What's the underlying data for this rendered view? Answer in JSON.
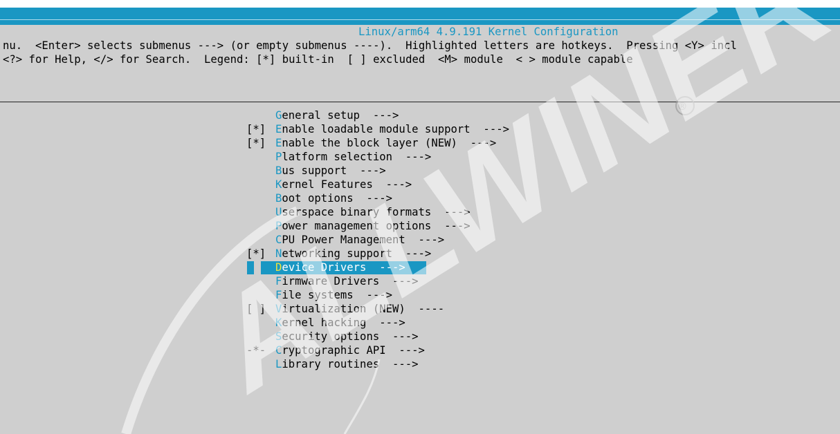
{
  "window": {
    "title": "Linux/arm64 4.9.191 Kernel Configuration"
  },
  "help": {
    "line1": "nu.  <Enter> selects submenus ---> (or empty submenus ----).  Highlighted letters are hotkeys.  Pressing <Y> incl",
    "line2": "<?> for Help, </> for Search.  Legend: [*] built-in  [ ] excluded  <M> module  < > module capable"
  },
  "menu": {
    "items": [
      {
        "prefix": "   ",
        "hotkey": "G",
        "rest": "eneral setup  --->",
        "selected": false
      },
      {
        "prefix": "[*]",
        "hotkey": "E",
        "rest": "nable loadable module support  --->",
        "selected": false
      },
      {
        "prefix": "[*]",
        "hotkey": "E",
        "rest": "nable the block layer (NEW)  --->",
        "selected": false
      },
      {
        "prefix": "   ",
        "hotkey": "P",
        "rest": "latform selection  --->",
        "selected": false
      },
      {
        "prefix": "   ",
        "hotkey": "B",
        "rest": "us support  --->",
        "selected": false
      },
      {
        "prefix": "   ",
        "hotkey": "K",
        "rest": "ernel Features  --->",
        "selected": false
      },
      {
        "prefix": "   ",
        "hotkey": "B",
        "rest": "oot options  --->",
        "selected": false
      },
      {
        "prefix": "   ",
        "hotkey": "U",
        "rest": "serspace binary formats  --->",
        "selected": false
      },
      {
        "prefix": "   ",
        "hotkey": "P",
        "rest": "ower management options  --->",
        "selected": false
      },
      {
        "prefix": "   ",
        "hotkey": "C",
        "rest": "PU Power Management  --->",
        "selected": false
      },
      {
        "prefix": "[*]",
        "hotkey": "N",
        "rest": "etworking support  --->",
        "selected": false
      },
      {
        "prefix": "   ",
        "hotkey": "D",
        "rest": "evice Drivers  --->",
        "selected": true
      },
      {
        "prefix": "   ",
        "hotkey": "F",
        "rest": "irmware Drivers  --->",
        "selected": false
      },
      {
        "prefix": "   ",
        "hotkey": "F",
        "rest": "ile systems  --->",
        "selected": false
      },
      {
        "prefix": "[ ]",
        "hotkey": "V",
        "rest": "irtualization (NEW)  ----",
        "selected": false
      },
      {
        "prefix": "   ",
        "hotkey": "K",
        "rest": "ernel hacking  --->",
        "selected": false
      },
      {
        "prefix": "   ",
        "hotkey": "S",
        "rest": "ecurity options  --->",
        "selected": false
      },
      {
        "prefix": "-*-",
        "hotkey": "C",
        "rest": "ryptographic API  --->",
        "selected": false
      },
      {
        "prefix": "   ",
        "hotkey": "L",
        "rest": "ibrary routines  --->",
        "selected": false
      }
    ]
  },
  "watermark": {
    "text": "ALLWINER",
    "mark": "®"
  },
  "colors": {
    "accent": "#1a97c3",
    "background": "#cfcfcf",
    "hotkey_selected": "#f0e23c"
  }
}
